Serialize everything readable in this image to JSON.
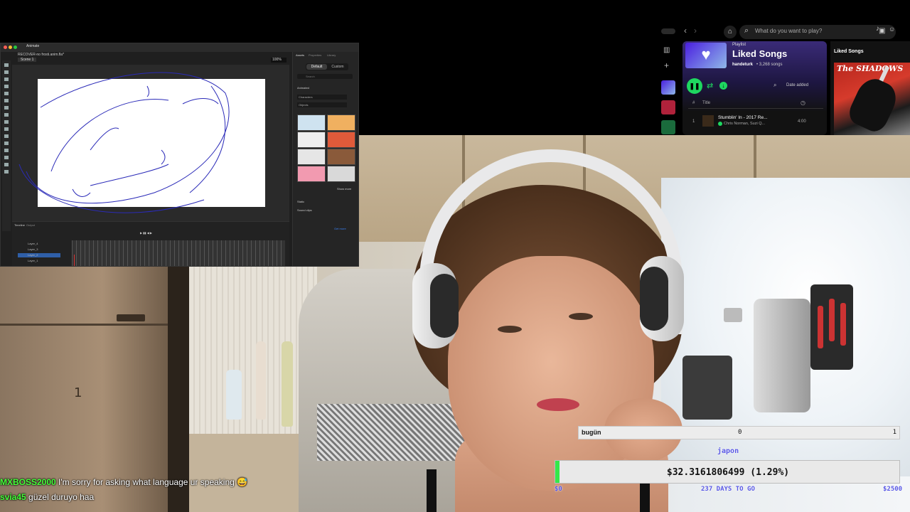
{
  "colors": {
    "spotify_green": "#1ed760",
    "chat_username": "#46ff3a",
    "goal_fill": "#35e84a",
    "goal_text_blue": "#5a59e6"
  },
  "animate": {
    "app_title": "Animate",
    "document_title": "RECOVER-no frosti.anim.fla*",
    "scene_tab": "Scene 1",
    "zoom": "100%",
    "assets_tabs": [
      "Default",
      "Custom"
    ],
    "search_placeholder": "Search",
    "animated_label": "Animated",
    "characters_select": "Characters",
    "objects_select": "Objects",
    "show_more": "Show more",
    "static_label": "Static",
    "sound_clips_label": "Sound clips",
    "get_more": "Get more",
    "timeline_tabs": [
      "Timeline",
      "Output"
    ],
    "layers": [
      "Layer_4",
      "Layer_3",
      "Layer_2",
      "Layer_1"
    ],
    "tool_icons": [
      "selection-icon",
      "subselection-icon",
      "free-transform-icon",
      "lasso-icon",
      "pen-icon",
      "text-icon",
      "line-icon",
      "rectangle-icon",
      "oval-icon",
      "pencil-icon",
      "brush-icon",
      "paint-bucket-icon",
      "eyedropper-icon",
      "eraser-icon",
      "hand-icon",
      "zoom-icon"
    ]
  },
  "spotify": {
    "search_placeholder": "What do you want to play?",
    "playlist_type": "Playlist",
    "playlist_title": "Liked Songs",
    "owner": "handeturk",
    "song_count": "• 3,268 songs",
    "sort_label": "Date added",
    "col_hash": "#",
    "col_title": "Title",
    "track_num": "1",
    "track_title": "Stumblin' In - 2017 Re...",
    "track_artist": "Chris Norman, Suzi Q...",
    "track_time": "4:00",
    "right_panel_title": "Liked Songs",
    "album_band": "The SHADOWS"
  },
  "chat": [
    {
      "user": "MXBOSS2000",
      "message": "I'm sorry for asking what language ur speaking 😅"
    },
    {
      "user": "svia45",
      "message": "güzel duruyo haa"
    }
  ],
  "goal": {
    "label": "bugün",
    "current": "0",
    "target": "1",
    "sub_label": "japon"
  },
  "money": {
    "amount": "$32.3161806499 (1.29%)",
    "progress_percent": 1.29,
    "start_label": "$0",
    "days_label": "237 DAYS TO GO",
    "end_label": "$2500"
  }
}
